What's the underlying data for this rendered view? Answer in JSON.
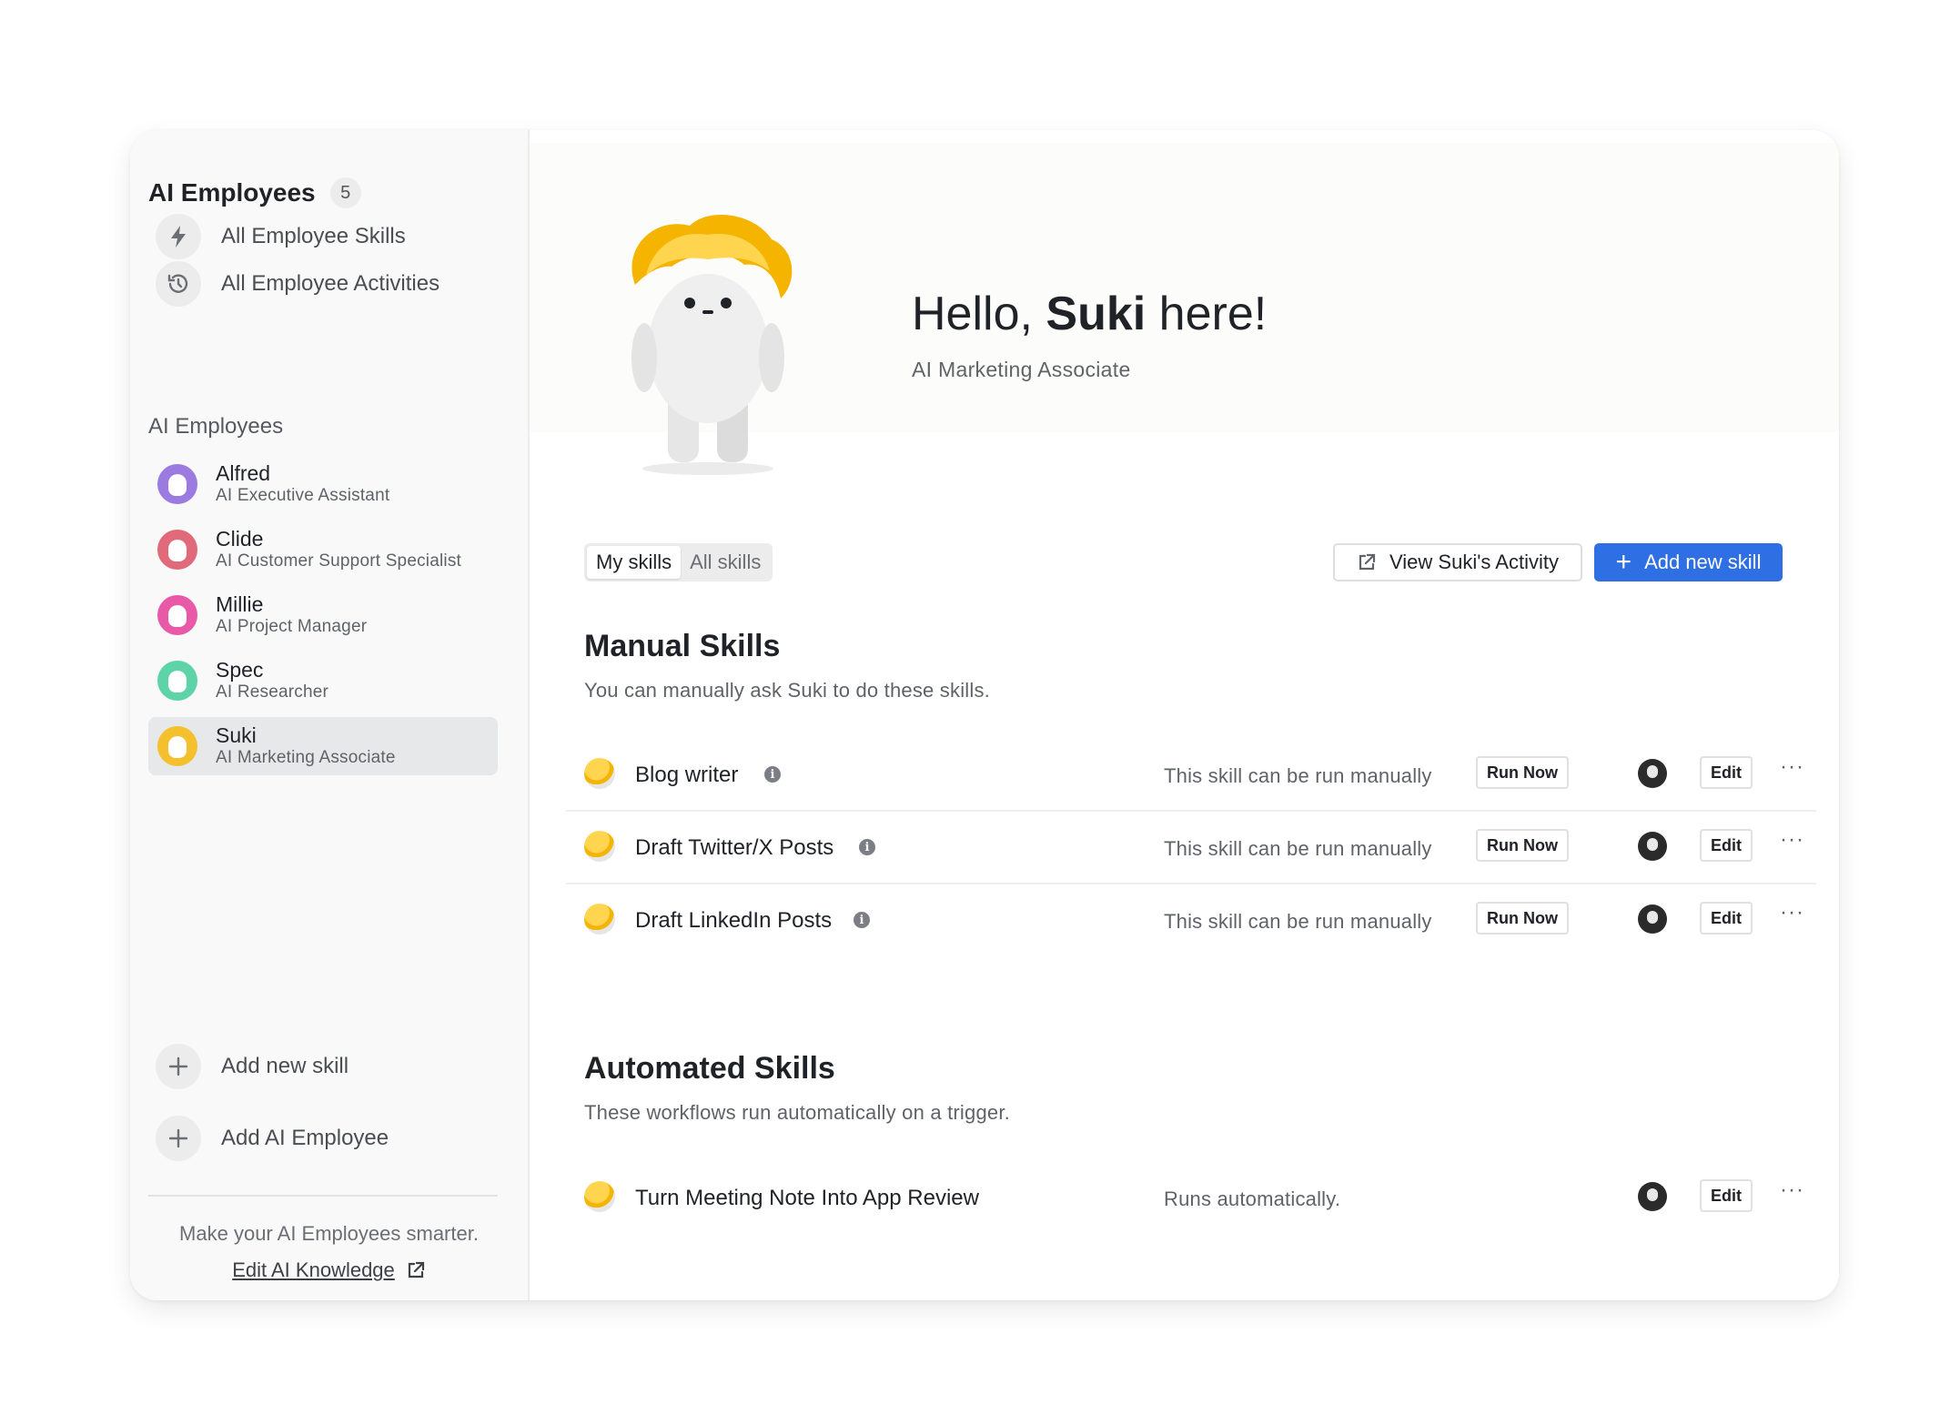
{
  "sidebar": {
    "title": "AI Employees",
    "count": "5",
    "links": [
      {
        "label": "All Employee Skills",
        "icon": "lightning-icon"
      },
      {
        "label": "All Employee Activities",
        "icon": "history-icon"
      }
    ],
    "section_label": "AI Employees",
    "employees": [
      {
        "name": "Alfred",
        "role": "AI Executive Assistant",
        "color": "#9b7be0"
      },
      {
        "name": "Clide",
        "role": "AI Customer Support Specialist",
        "color": "#e06a7a"
      },
      {
        "name": "Millie",
        "role": "AI Project Manager",
        "color": "#e85aa8"
      },
      {
        "name": "Spec",
        "role": "AI Researcher",
        "color": "#5fd3a8"
      },
      {
        "name": "Suki",
        "role": "AI Marketing Associate",
        "color": "#f5c02e"
      }
    ],
    "active_employee": "Suki",
    "actions": [
      {
        "label": "Add new skill",
        "icon": "plus-icon"
      },
      {
        "label": "Add AI Employee",
        "icon": "plus-icon"
      }
    ],
    "footer_message": "Make your AI Employees smarter.",
    "footer_link": "Edit AI Knowledge"
  },
  "header": {
    "greeting_prefix": "Hello, ",
    "greeting_name": "Suki",
    "greeting_suffix": " here!",
    "subtitle": "AI Marketing Associate"
  },
  "toolbar": {
    "tabs": [
      {
        "label": "My skills",
        "active": true
      },
      {
        "label": "All skills",
        "active": false
      }
    ],
    "activity_button": "View Suki's Activity",
    "add_skill_button": "Add new skill"
  },
  "manual": {
    "title": "Manual Skills",
    "description": "You can manually ask Suki to do these skills.",
    "skills": [
      {
        "name": "Blog writer",
        "status": "This skill can be run manually",
        "run_label": "Run Now",
        "edit_label": "Edit",
        "more": "···"
      },
      {
        "name": "Draft Twitter/X Posts",
        "status": "This skill can be run manually",
        "run_label": "Run Now",
        "edit_label": "Edit",
        "more": "···"
      },
      {
        "name": "Draft LinkedIn Posts",
        "status": "This skill can be run manually",
        "run_label": "Run Now",
        "edit_label": "Edit",
        "more": "···"
      }
    ]
  },
  "automated": {
    "title": "Automated Skills",
    "description": "These workflows run automatically on a trigger.",
    "skills": [
      {
        "name": "Turn Meeting Note Into App Review",
        "status": "Runs automatically.",
        "edit_label": "Edit",
        "more": "···"
      }
    ]
  },
  "colors": {
    "primary": "#2f6fe4",
    "mascot_hair": "#f5b400"
  }
}
